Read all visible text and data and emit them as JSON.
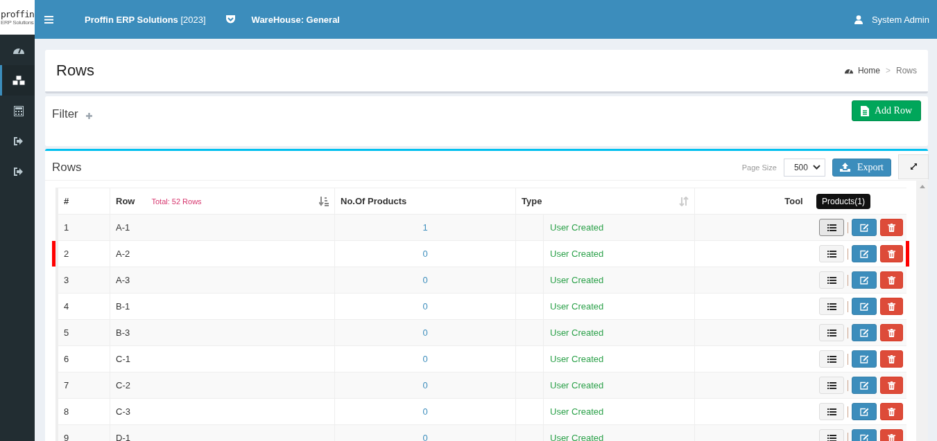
{
  "logo": {
    "name": "proffin",
    "tagline": "ERP Solutions"
  },
  "header": {
    "app_name": "Proffin ERP Solutions",
    "year": "[2023]",
    "warehouse": "WareHouse: General",
    "user": "System Admin"
  },
  "sidebar": {
    "items": [
      {
        "kind": "dashboard",
        "selected": false
      },
      {
        "kind": "cubes",
        "selected": true
      },
      {
        "kind": "calculator",
        "selected": false
      },
      {
        "kind": "sign-out",
        "selected": false
      },
      {
        "kind": "sign-out",
        "selected": false
      }
    ]
  },
  "page": {
    "title": "Rows",
    "breadcrumb": [
      "Home",
      "Rows"
    ],
    "breadcrumb_separator": ">"
  },
  "filter": {
    "title": "Filter",
    "add_button": "Add Row"
  },
  "list": {
    "title": "Rows",
    "page_size_label": "Page Size",
    "page_size": "500",
    "export_button": "Export"
  },
  "table": {
    "columns": [
      "#",
      "Row",
      "No.Of Products",
      "Type",
      "Tool"
    ],
    "total": "Total: 52 Rows",
    "tooltip": "Products(1)",
    "rows": [
      {
        "no": "1",
        "row": "A-1",
        "products": "1",
        "type": "User Created",
        "flagged": false,
        "hovered": true
      },
      {
        "no": "2",
        "row": "A-2",
        "products": "0",
        "type": "User Created",
        "flagged": true,
        "hovered": false
      },
      {
        "no": "3",
        "row": "A-3",
        "products": "0",
        "type": "User Created",
        "flagged": false,
        "hovered": false
      },
      {
        "no": "4",
        "row": "B-1",
        "products": "0",
        "type": "User Created",
        "flagged": false,
        "hovered": false
      },
      {
        "no": "5",
        "row": "B-3",
        "products": "0",
        "type": "User Created",
        "flagged": false,
        "hovered": false
      },
      {
        "no": "6",
        "row": "C-1",
        "products": "0",
        "type": "User Created",
        "flagged": false,
        "hovered": false
      },
      {
        "no": "7",
        "row": "C-2",
        "products": "0",
        "type": "User Created",
        "flagged": false,
        "hovered": false
      },
      {
        "no": "8",
        "row": "C-3",
        "products": "0",
        "type": "User Created",
        "flagged": false,
        "hovered": false
      },
      {
        "no": "9",
        "row": "D-1",
        "products": "0",
        "type": "User Created",
        "flagged": false,
        "hovered": false
      }
    ]
  }
}
